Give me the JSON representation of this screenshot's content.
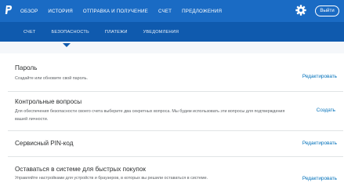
{
  "nav": {
    "main": [
      "ОБЗОР",
      "ИСТОРИЯ",
      "ОТПРАВКА И ПОЛУЧЕНИЕ",
      "СЧЕТ",
      "ПРЕДЛОЖЕНИЯ"
    ],
    "logout": "Выйти"
  },
  "subnav": [
    "СЧЕТ",
    "БЕЗОПАСНОСТЬ",
    "ПЛАТЕЖИ",
    "УВЕДОМЛЕНИЯ"
  ],
  "active_subnav": "БЕЗОПАСНОСТЬ",
  "sections": [
    {
      "title": "Пароль",
      "description": "Создайте или обновите свой пароль.",
      "action": "Редактировать"
    },
    {
      "title": "Контрольные вопросы",
      "description": "Для обеспечения безопасности своего счета выберите два секретных вопроса. Мы будем использовать эти вопросы для подтверждения вашей личности.",
      "action": "Создать"
    },
    {
      "title": "Сервисный PIN-код",
      "description": "",
      "action": "Редактировать"
    },
    {
      "title": "Оставаться в системе для быстрых покупок",
      "description": "Управляйте настройками для устройств и браузеров, в которых вы решили оставаться в системе.",
      "action": "Редактировать"
    }
  ],
  "colors": {
    "topbar": "#1a6bc4",
    "subbar": "#0f5aae",
    "link": "#0070ba"
  },
  "icons": {
    "logo": "paypal-logo",
    "settings": "gear-icon"
  }
}
